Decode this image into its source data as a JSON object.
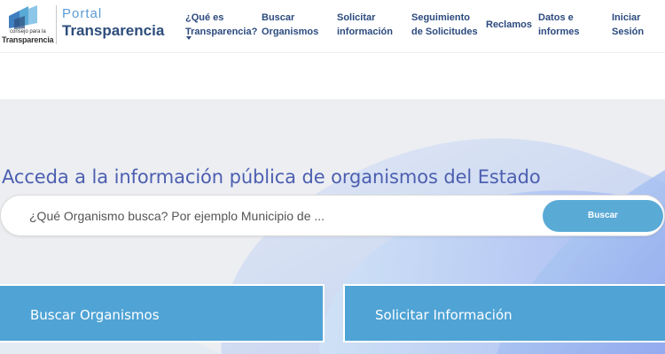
{
  "logo": {
    "small_text": "consejo para la",
    "brand_text": "Transparencia",
    "portal_text": "Portal",
    "title_text": "Transparencia"
  },
  "nav": {
    "items": [
      {
        "line1": "¿Qué es",
        "line2": "Transparencia?"
      },
      {
        "line1": "Buscar",
        "line2": "Organismos"
      },
      {
        "line1": "Solicitar",
        "line2": "información"
      },
      {
        "line1": "Seguimiento",
        "line2": "de Solicitudes"
      },
      {
        "line1": "Reclamos",
        "line2": ""
      },
      {
        "line1": "Datos e",
        "line2": "informes"
      },
      {
        "line1": "Iniciar",
        "line2": "Sesión"
      }
    ]
  },
  "hero": {
    "headline": "Acceda a la información pública de organismos del Estado",
    "search_placeholder": "¿Qué Organismo busca? Por ejemplo Municipio de ...",
    "search_value": "",
    "search_button": "Buscar"
  },
  "cards": [
    {
      "label": "Buscar Organismos"
    },
    {
      "label": "Solicitar Información"
    }
  ],
  "colors": {
    "nav_text": "#2b4a7e",
    "headline": "#4c5fb0",
    "button": "#5aaad6",
    "card": "#4fa3d5"
  }
}
